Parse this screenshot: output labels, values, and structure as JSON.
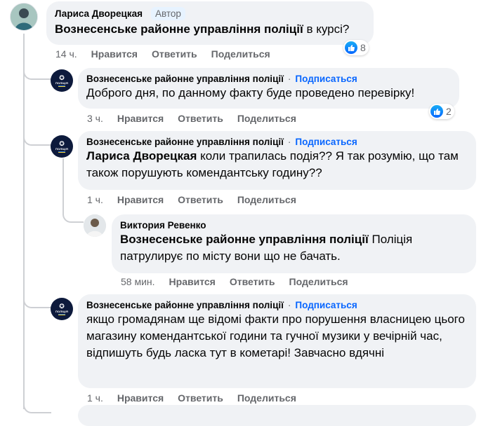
{
  "comments": [
    {
      "author": "Лариса Дворецкая",
      "badge": "Автор",
      "text_mention": "Вознесенське районне управління поліції",
      "text_rest": " в курсі?",
      "time": "14 ч.",
      "like": "Нравится",
      "reply": "Ответить",
      "share": "Поделиться",
      "reactions": "8"
    },
    {
      "author": "Вознесенське районне управління поліції",
      "dot": "·",
      "follow": "Подписаться",
      "text": "Доброго дня, по данному факту буде проведено перевірку!",
      "time": "3 ч.",
      "like": "Нравится",
      "reply": "Ответить",
      "share": "Поделиться",
      "reactions": "2"
    },
    {
      "author": "Вознесенське районне управління поліції",
      "dot": "·",
      "follow": "Подписаться",
      "text_mention": "Лариса Дворецкая",
      "text_rest": " коли трапилась подія?? Я так розумію, що там також порушують комендантську годину??",
      "time": "1 ч.",
      "like": "Нравится",
      "reply": "Ответить",
      "share": "Поделиться"
    },
    {
      "author": "Виктория Ревенко",
      "text_mention": "Вознесенське районне управління поліції",
      "text_rest": " Поліція патрулирує по місту вони що не бачать.",
      "time": "58 мин.",
      "like": "Нравится",
      "reply": "Ответить",
      "share": "Поделиться"
    },
    {
      "author": "Вознесенське районне управління поліції",
      "dot": "·",
      "follow": "Подписаться",
      "text": "якщо громадянам ще відомі факти про порушення власницею цього магазину комендантської години та гучної музики у вечірній час, відпишуть будь ласка тут в кометарі! Завчасно вдячні",
      "time": "1 ч.",
      "like": "Нравится",
      "reply": "Ответить",
      "share": "Поделиться"
    }
  ],
  "police_avatar_text": "ПОЛІЦІЯ",
  "colors": {
    "link": "#0866ff",
    "bubble": "#f0f2f5",
    "meta": "#65676b",
    "like": "#0866ff"
  }
}
